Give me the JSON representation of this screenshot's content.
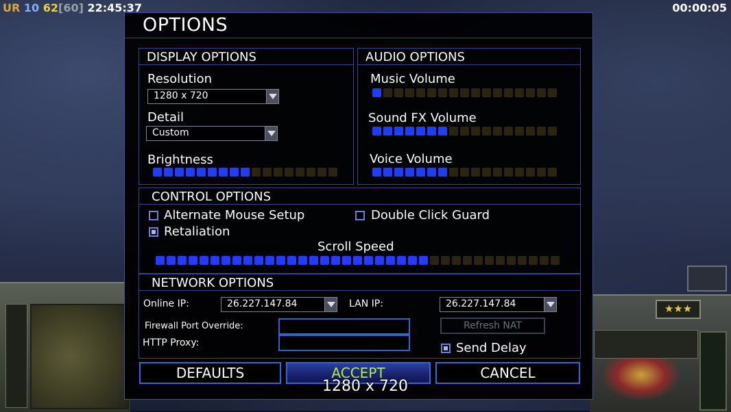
{
  "topbar": {
    "faction": "UR",
    "level": "10",
    "fps": "62",
    "fps_cap": "[60]",
    "clock": "22:45:37",
    "elapsed": "00:00:05"
  },
  "dialog": {
    "title": "OPTIONS"
  },
  "display": {
    "header": "DISPLAY OPTIONS",
    "resolution_label": "Resolution",
    "resolution_value": "1280 x 720",
    "detail_label": "Detail",
    "detail_value": "Custom",
    "brightness_label": "Brightness",
    "brightness_level": 9,
    "brightness_total": 17
  },
  "audio": {
    "header": "AUDIO OPTIONS",
    "music_label": "Music Volume",
    "music_level": 1,
    "music_total": 17,
    "sfx_label": "Sound FX Volume",
    "sfx_level": 7,
    "sfx_total": 17,
    "voice_label": "Voice Volume",
    "voice_level": 7,
    "voice_total": 17
  },
  "control": {
    "header": "CONTROL OPTIONS",
    "alt_mouse_label": "Alternate Mouse Setup",
    "alt_mouse_checked": false,
    "double_click_label": "Double Click Guard",
    "double_click_checked": false,
    "retaliation_label": "Retaliation",
    "retaliation_checked": true,
    "scroll_label": "Scroll Speed",
    "scroll_level": 25,
    "scroll_total": 37
  },
  "network": {
    "header": "NETWORK OPTIONS",
    "online_ip_label": "Online IP:",
    "online_ip_value": "26.227.147.84",
    "lan_ip_label": "LAN IP:",
    "lan_ip_value": "26.227.147.84",
    "firewall_label": "Firewall Port Override:",
    "firewall_value": "",
    "proxy_label": "HTTP Proxy:",
    "proxy_value": "",
    "refresh_nat_label": "Refresh NAT",
    "send_delay_label": "Send Delay",
    "send_delay_checked": true
  },
  "buttons": {
    "defaults": "DEFAULTS",
    "accept": "ACCEPT",
    "cancel": "CANCEL"
  },
  "tooltip": "1280 x 720",
  "colors": {
    "panel_border": "#36468f",
    "slider_on": "#1f3cff",
    "slider_off": "#2a2410",
    "accept_text": "#b6ee3c",
    "button_border": "#2b6ae0"
  }
}
